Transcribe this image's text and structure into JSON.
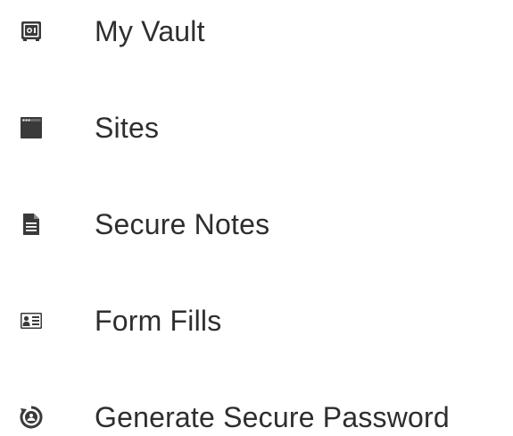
{
  "menu": {
    "items": [
      {
        "label": "My Vault",
        "icon": "vault-icon"
      },
      {
        "label": "Sites",
        "icon": "browser-window-icon"
      },
      {
        "label": "Secure Notes",
        "icon": "document-icon"
      },
      {
        "label": "Form Fills",
        "icon": "id-card-icon"
      },
      {
        "label": "Generate Secure Password",
        "icon": "password-generator-icon"
      }
    ]
  },
  "colors": {
    "icon": "#3a3a3a",
    "text": "#2e2e2e",
    "background": "#ffffff"
  }
}
